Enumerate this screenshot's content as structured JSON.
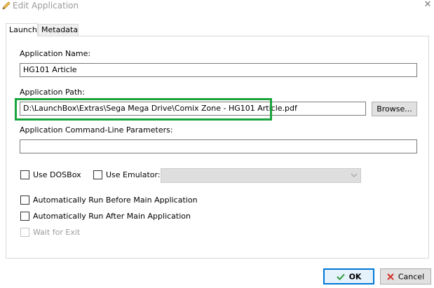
{
  "window": {
    "title": "Edit Application",
    "close_glyph": "✕"
  },
  "tabs": [
    {
      "label": "Launch",
      "active": true
    },
    {
      "label": "Metadata",
      "active": false
    }
  ],
  "form": {
    "name_label": "Application Name:",
    "name_value": "HG101 Article",
    "path_label": "Application Path:",
    "path_value": "D:\\LaunchBox\\Extras\\Sega Mega Drive\\Comix Zone - HG101 Article.pdf",
    "browse_label": "Browse...",
    "params_label": "Application Command-Line Parameters:",
    "params_value": "",
    "use_dosbox_label": "Use DOSBox",
    "use_emulator_label": "Use Emulator:",
    "emulator_value": "",
    "run_before_label": "Automatically Run Before Main Application",
    "run_after_label": "Automatically Run After Main Application",
    "wait_exit_label": "Wait for Exit"
  },
  "buttons": {
    "ok_label": "OK",
    "cancel_label": "Cancel"
  },
  "colors": {
    "highlight": "#1aa43c",
    "ok_border": "#0078d7",
    "ok_check": "#2e9c3c",
    "cancel_x": "#d2322d"
  },
  "icons": {
    "title": "pencil-icon",
    "ok": "checkmark-icon",
    "cancel": "x-icon",
    "dropdown": "chevron-down-icon"
  }
}
